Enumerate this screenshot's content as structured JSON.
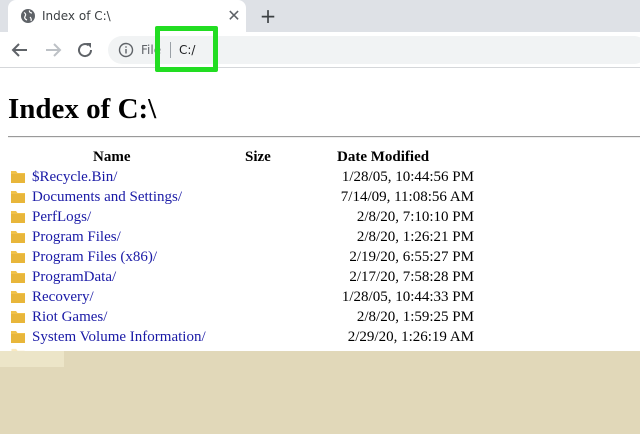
{
  "browser": {
    "tab": {
      "title": "Index of C:\\",
      "close_glyph": "✕"
    },
    "new_tab_glyph": "+",
    "omnibox": {
      "scheme_label": "File",
      "url": "C:/"
    },
    "highlight_color": "#22dd22"
  },
  "page": {
    "title": "Index of C:\\",
    "columns": {
      "name": "Name",
      "size": "Size",
      "date": "Date Modified"
    },
    "entries": [
      {
        "name": "$Recycle.Bin/",
        "size": "",
        "date": "1/28/05, 10:44:56 PM"
      },
      {
        "name": "Documents and Settings/",
        "size": "",
        "date": "7/14/09, 11:08:56 AM"
      },
      {
        "name": "PerfLogs/",
        "size": "",
        "date": "2/8/20, 7:10:10 PM"
      },
      {
        "name": "Program Files/",
        "size": "",
        "date": "2/8/20, 1:26:21 PM"
      },
      {
        "name": "Program Files (x86)/",
        "size": "",
        "date": "2/19/20, 6:55:27 PM"
      },
      {
        "name": "ProgramData/",
        "size": "",
        "date": "2/17/20, 7:58:28 PM"
      },
      {
        "name": "Recovery/",
        "size": "",
        "date": "1/28/05, 10:44:33 PM"
      },
      {
        "name": "Riot Games/",
        "size": "",
        "date": "2/8/20, 1:59:25 PM"
      },
      {
        "name": "System Volume Information/",
        "size": "",
        "date": "2/29/20, 1:26:19 AM"
      }
    ]
  },
  "colors": {
    "link": "#1a1aa6",
    "folder": "#f0c24a",
    "overlay": "#e1d8b9"
  }
}
